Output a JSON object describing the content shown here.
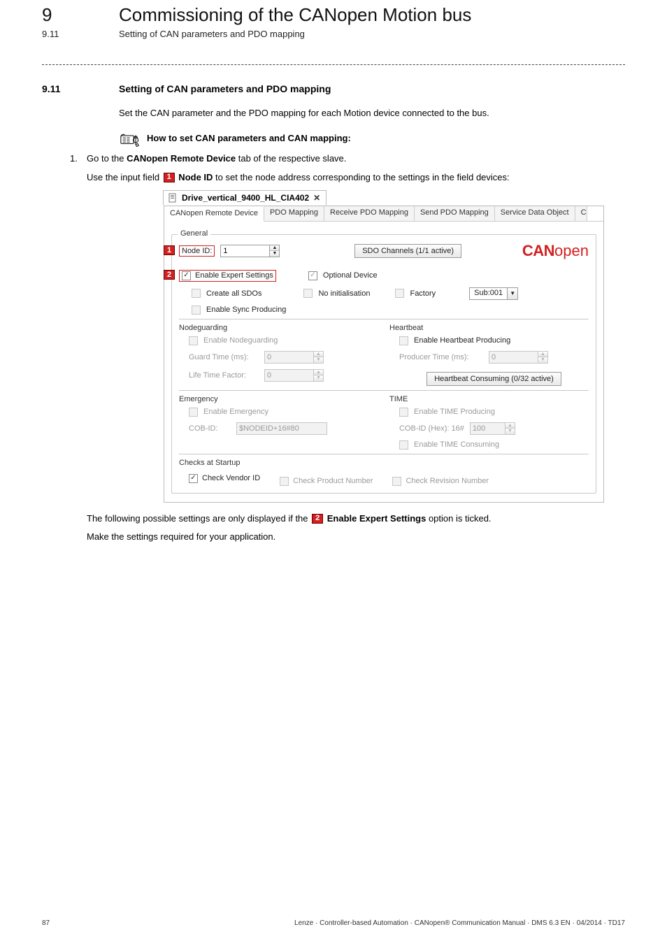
{
  "header": {
    "chapter_num": "9",
    "chapter_title": "Commissioning of the CANopen Motion bus",
    "sub_num": "9.11",
    "sub_title": "Setting of CAN parameters and PDO mapping"
  },
  "section": {
    "num": "9.11",
    "title": "Setting of CAN parameters and PDO mapping",
    "intro": "Set the CAN parameter and the PDO mapping for each Motion device connected to the bus.",
    "howto_label": "How to set CAN parameters and CAN mapping:",
    "step1_num": "1.",
    "step1_prefix": "Go to the ",
    "step1_bold": "CANopen Remote Device",
    "step1_suffix": " tab of the respective slave.",
    "step1b_prefix": "Use the input field ",
    "step1b_marker": "1",
    "step1b_bold": " Node ID",
    "step1b_suffix": " to set the node address corresponding to the settings in the field devices:",
    "after1_prefix": "The following possible settings are only displayed if the ",
    "after1_marker": "2",
    "after1_bold": " Enable Expert Settings",
    "after1_suffix": " option is ticked.",
    "after2": "Make the settings required for your application."
  },
  "shot": {
    "tab_title": "Drive_vertical_9400_HL_CIA402",
    "tab_close": "✕",
    "tabs": {
      "t1": "CANopen Remote Device",
      "t2": "PDO Mapping",
      "t3": "Receive PDO Mapping",
      "t4": "Send PDO Mapping",
      "t5": "Service Data Object"
    },
    "general": {
      "legend": "General",
      "node_id_label": "Node ID:",
      "node_id_value": "1",
      "sdo_btn": "SDO Channels (1/1 active)",
      "logo_can": "CAN",
      "logo_open": "open",
      "enable_expert": "Enable Expert Settings",
      "optional_device": "Optional Device",
      "create_all_sdos": "Create all SDOs",
      "no_init": "No initialisation",
      "factory": "Factory",
      "subselect": "Sub:001",
      "enable_sync": "Enable Sync Producing"
    },
    "nodeguarding": {
      "legend": "Nodeguarding",
      "enable": "Enable Nodeguarding",
      "guard_time": "Guard Time (ms):",
      "guard_time_val": "0",
      "life_time": "Life Time Factor:",
      "life_time_val": "0"
    },
    "heartbeat": {
      "legend": "Heartbeat",
      "enable": "Enable Heartbeat Producing",
      "producer_time": "Producer Time (ms):",
      "producer_time_val": "0",
      "consuming_btn": "Heartbeat Consuming (0/32 active)"
    },
    "emergency": {
      "legend": "Emergency",
      "enable": "Enable Emergency",
      "cobid_label": "COB-ID:",
      "cobid_val": "$NODEID+16#80"
    },
    "time": {
      "legend": "TIME",
      "enable_producing": "Enable TIME Producing",
      "cobid_label": "COB-ID (Hex):   16#",
      "cobid_val": "100",
      "enable_consuming": "Enable TIME Consuming"
    },
    "checks": {
      "legend": "Checks at Startup",
      "vendor": "Check Vendor ID",
      "product": "Check Product Number",
      "revision": "Check Revision Number"
    }
  },
  "footer": {
    "page": "87",
    "right": "Lenze · Controller-based Automation · CANopen® Communication Manual · DMS 6.3 EN · 04/2014 · TD17"
  }
}
